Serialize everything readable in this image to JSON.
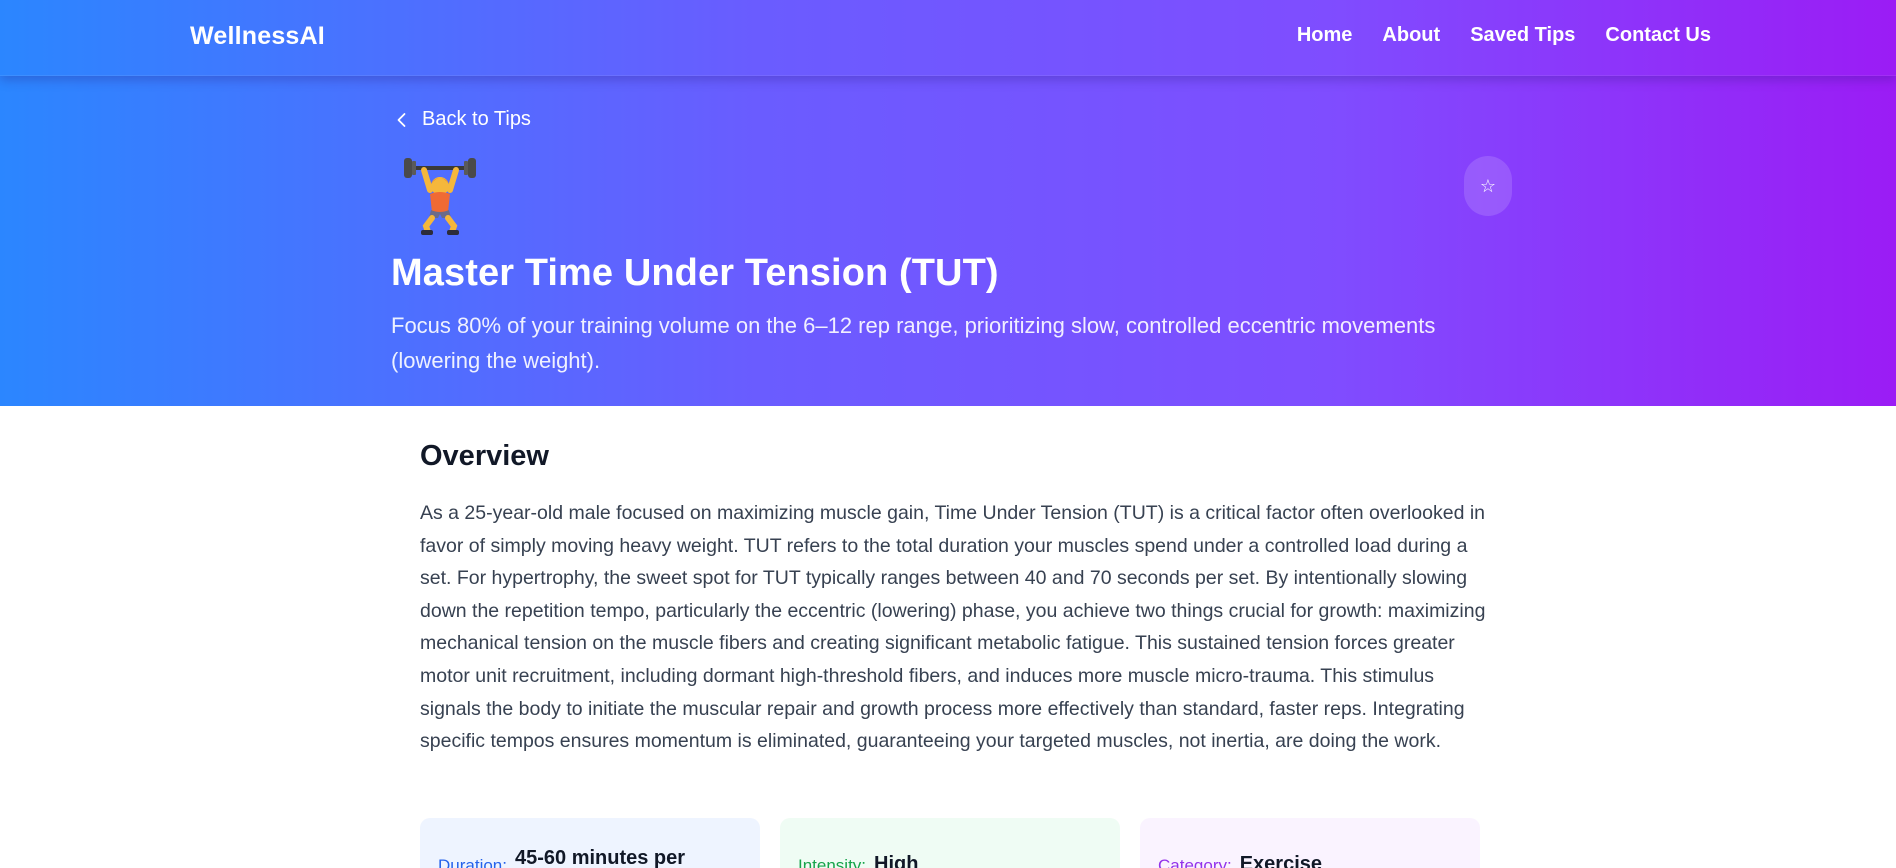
{
  "nav": {
    "brand": "WellnessAI",
    "links": [
      "Home",
      "About",
      "Saved Tips",
      "Contact Us"
    ]
  },
  "hero": {
    "back_label": "Back to Tips",
    "emoji_icon": "weightlifter-emoji",
    "save_icon": "☆",
    "title": "Master Time Under Tension (TUT)",
    "subtitle": "Focus 80% of your training volume on the 6–12 rep range, prioritizing slow, controlled eccentric movements (lowering the weight)."
  },
  "overview": {
    "heading": "Overview",
    "body": "As a 25-year-old male focused on maximizing muscle gain, Time Under Tension (TUT) is a critical factor often overlooked in favor of simply moving heavy weight. TUT refers to the total duration your muscles spend under a controlled load during a set. For hypertrophy, the sweet spot for TUT typically ranges between 40 and 70 seconds per set. By intentionally slowing down the repetition tempo, particularly the eccentric (lowering) phase, you achieve two things crucial for growth: maximizing mechanical tension on the muscle fibers and creating significant metabolic fatigue. This sustained tension forces greater motor unit recruitment, including dormant high-threshold fibers, and induces more muscle micro-trauma. This stimulus signals the body to initiate the muscular repair and growth process more effectively than standard, faster reps. Integrating specific tempos ensures momentum is eliminated, guaranteeing your targeted muscles, not inertia, are doing the work."
  },
  "cards": {
    "duration": {
      "label": "Duration:",
      "value": "45-60 minutes per"
    },
    "intensity": {
      "label": "Intensity:",
      "value": "High"
    },
    "category": {
      "label": "Category:",
      "value": "Exercise"
    }
  },
  "colors": {
    "gradient_start": "#2b86ff",
    "gradient_mid": "#7f4dff",
    "gradient_end": "#9b1cf5",
    "duration_accent": "#2563eb",
    "intensity_accent": "#16a34a",
    "category_accent": "#9333ea"
  }
}
